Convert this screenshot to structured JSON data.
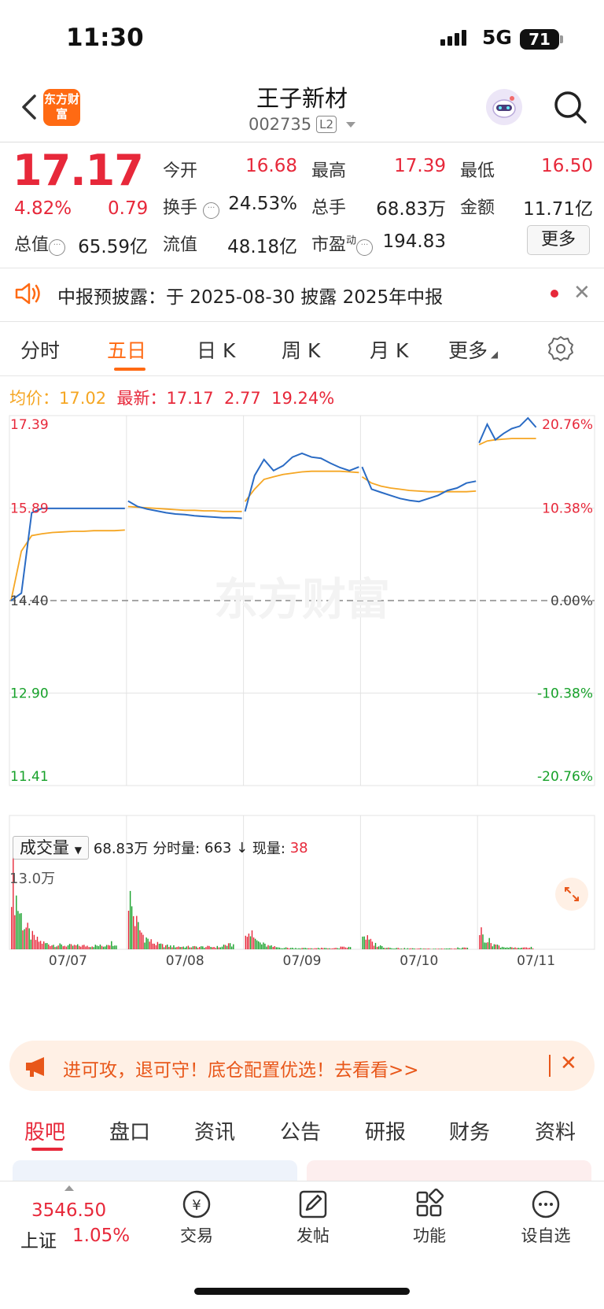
{
  "status_bar": {
    "time": "11:30",
    "network": "5G",
    "battery": "71"
  },
  "header": {
    "logo_text": "东方财富",
    "stock_name": "王子新材",
    "stock_code": "002735",
    "level_badge": "L2"
  },
  "quote": {
    "price": "17.17",
    "change_pct": "4.82%",
    "change_amt": "0.79",
    "open_label": "今开",
    "open": "16.68",
    "high_label": "最高",
    "high": "17.39",
    "low_label": "最低",
    "low": "16.50",
    "turnover_label": "换手",
    "turnover": "24.53%",
    "volume_label": "总手",
    "volume": "68.83万",
    "amount_label": "金额",
    "amount": "11.71亿",
    "mcap_label": "总值",
    "mcap": "65.59亿",
    "float_label": "流值",
    "float_cap": "48.18亿",
    "pe_label": "市盈",
    "pe_sup": "动",
    "pe": "194.83",
    "more_label": "更多"
  },
  "notice": {
    "text": "中报预披露：于 2025-08-30 披露 2025年中报"
  },
  "period_tabs": [
    "分时",
    "五日",
    "日 K",
    "周 K",
    "月 K",
    "更多"
  ],
  "active_period": 1,
  "chart_info": {
    "avg_label": "均价：",
    "avg": "17.02",
    "latest_label": "最新：",
    "latest": "17.17",
    "latest_chg": "2.77",
    "latest_pct": "19.24%"
  },
  "volume_info": {
    "select_label": "成交量",
    "total": "68.83万",
    "minute_label": "分时量:",
    "minute": "663 ↓",
    "now_label": "现量:",
    "now": "38",
    "max_label": "13.0万"
  },
  "watermark": "东方财富",
  "banner": {
    "text": "进可攻，退可守！底仓配置优选！去看看>>"
  },
  "bottom_tabs": [
    "股吧",
    "盘口",
    "资讯",
    "公告",
    "研报",
    "财务",
    "资料"
  ],
  "bottom_nav": {
    "index_value": "3546.50",
    "index_name": "上证",
    "index_change": "1.05%",
    "items": [
      "交易",
      "发帖",
      "功能",
      "设自选"
    ]
  },
  "colors": {
    "up": "#e7283a",
    "down": "#17a12a",
    "accent": "#ff6a13",
    "price_line": "#2a6bc4",
    "avg_line": "#f5a623"
  },
  "chart_data": {
    "type": "line",
    "y_price_ticks": [
      "17.39",
      "15.89",
      "14.40",
      "12.90",
      "11.41"
    ],
    "y_pct_ticks": [
      "20.76%",
      "10.38%",
      "0.00%",
      "-10.38%",
      "-20.76%"
    ],
    "ylim": [
      11.41,
      17.39
    ],
    "prev_close": 14.4,
    "x_labels": [
      "07/07",
      "07/08",
      "07/09",
      "07/10",
      "07/11"
    ],
    "days": [
      {
        "label": "07/07",
        "price": [
          14.4,
          14.52,
          15.82,
          15.89,
          15.89,
          15.89,
          15.89,
          15.89,
          15.89,
          15.89,
          15.89,
          15.89
        ],
        "avg": [
          14.4,
          15.2,
          15.45,
          15.48,
          15.5,
          15.51,
          15.52,
          15.52,
          15.53,
          15.53,
          15.53,
          15.54
        ]
      },
      {
        "label": "07/08",
        "price": [
          16.01,
          15.92,
          15.88,
          15.85,
          15.82,
          15.8,
          15.79,
          15.77,
          15.76,
          15.75,
          15.74,
          15.74,
          15.73
        ],
        "avg": [
          15.92,
          15.91,
          15.9,
          15.89,
          15.88,
          15.87,
          15.86,
          15.86,
          15.85,
          15.85,
          15.84,
          15.84,
          15.84
        ]
      },
      {
        "label": "07/09",
        "price": [
          15.84,
          16.42,
          16.68,
          16.5,
          16.58,
          16.72,
          16.78,
          16.72,
          16.7,
          16.62,
          16.55,
          16.5,
          16.56
        ],
        "avg": [
          16.0,
          16.2,
          16.36,
          16.4,
          16.44,
          16.46,
          16.48,
          16.49,
          16.49,
          16.49,
          16.49,
          16.48,
          16.47
        ]
      },
      {
        "label": "07/10",
        "price": [
          16.56,
          16.2,
          16.15,
          16.1,
          16.05,
          16.02,
          16.0,
          16.05,
          16.1,
          16.18,
          16.22,
          16.3,
          16.33
        ],
        "avg": [
          16.4,
          16.3,
          16.25,
          16.22,
          16.2,
          16.18,
          16.17,
          16.16,
          16.16,
          16.16,
          16.16,
          16.16,
          16.17
        ]
      },
      {
        "label": "07/11",
        "price": [
          16.95,
          17.25,
          17.0,
          17.1,
          17.18,
          17.22,
          17.35,
          17.2
        ],
        "avg": [
          16.92,
          16.98,
          17.0,
          17.01,
          17.02,
          17.02,
          17.02,
          17.02
        ]
      }
    ],
    "volume_ylim": [
      0,
      130000
    ],
    "volume_peaks": [
      {
        "day": "07/07",
        "peak": 125000
      },
      {
        "day": "07/08",
        "peak": 85000
      },
      {
        "day": "07/09",
        "peak": 38000
      },
      {
        "day": "07/10",
        "peak": 25000
      },
      {
        "day": "07/11",
        "peak": 30000
      }
    ]
  }
}
